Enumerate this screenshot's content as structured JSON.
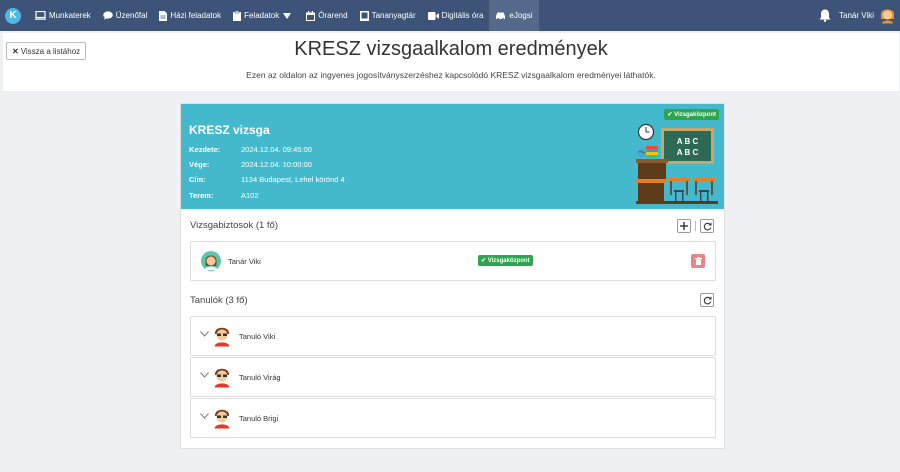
{
  "nav": {
    "items": [
      {
        "label": "Munkaterek",
        "icon": "monitor-icon"
      },
      {
        "label": "Üzenőfal",
        "icon": "chat-icon"
      },
      {
        "label": "Házi feladatok",
        "icon": "document-icon"
      },
      {
        "label": "Feladatok",
        "icon": "tasks-icon"
      },
      {
        "label": "Órarend",
        "icon": "calendar-icon"
      },
      {
        "label": "Tananyagtár",
        "icon": "book-icon"
      },
      {
        "label": "Digitális óra",
        "icon": "video-icon"
      },
      {
        "label": "eJogsi",
        "icon": "car-icon"
      }
    ],
    "user_name": "Tanár Viki"
  },
  "header": {
    "back_label": "Vissza a listához",
    "title": "KRESZ vizsgaalkalom eredmények",
    "subtitle": "Ezen az oldalon az ingyenes jogosítványszerzéshez kapcsolódó KRESZ vizsgaalkalom eredményei láthatók."
  },
  "exam": {
    "title": "KRESZ vizsga",
    "badge": "Vizsgaközpont",
    "details": [
      {
        "label": "Kezdete:",
        "value": "2024.12.04. 09:45:00"
      },
      {
        "label": "Vége:",
        "value": "2024.12.04. 10:00:00"
      },
      {
        "label": "Cím:",
        "value": "1134 Budapest, Lehel körönd 4"
      },
      {
        "label": "Terem:",
        "value": "A102"
      }
    ],
    "board_text": [
      "A B C",
      "A B C"
    ]
  },
  "examiners": {
    "title": "Vizsgabiztosok (1 fő)",
    "items": [
      {
        "name": "Tanár Viki",
        "badge": "Vizsgaközpont"
      }
    ]
  },
  "students": {
    "title": "Tanulók (3 fő)",
    "items": [
      {
        "name": "Tanuló Viki"
      },
      {
        "name": "Tanuló Virág"
      },
      {
        "name": "Tanuló Brigi"
      }
    ]
  },
  "colors": {
    "navbar": "#3d5478",
    "exam_header": "#45b9cc",
    "badge_green": "#2ea44f",
    "delete_red": "#e8848a"
  }
}
